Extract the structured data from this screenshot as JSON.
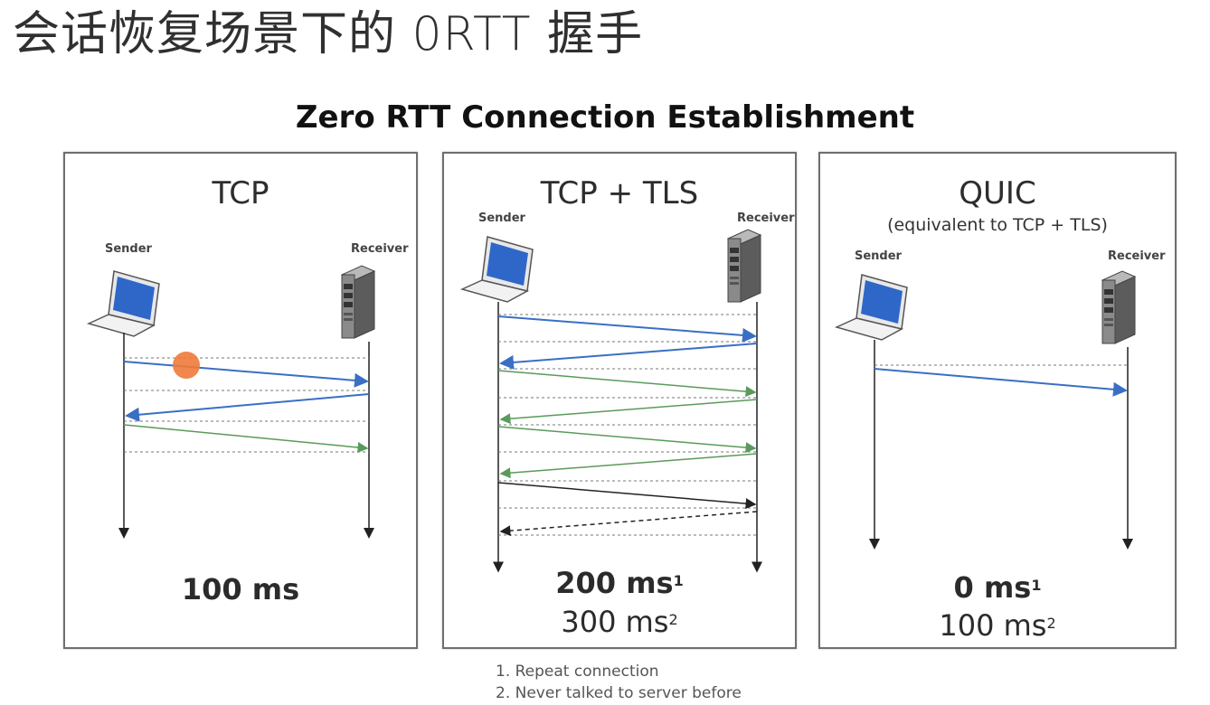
{
  "slide_title": "会话恢复场景下的 0RTT 握手",
  "figure_title": "Zero RTT Connection Establishment",
  "colors": {
    "blue_arrow": "#3a6fc4",
    "green_arrow": "#5a9a5a",
    "black_arrow": "#222222",
    "laptop_screen": "#2f67c8",
    "server_body": "#7a7a7a",
    "cursor": "#f07a3a"
  },
  "panels": {
    "tcp": {
      "title": "TCP",
      "sender": "Sender",
      "receiver": "Receiver",
      "timing_main": "100 ms"
    },
    "tls": {
      "title": "TCP + TLS",
      "sender": "Sender",
      "receiver": "Receiver",
      "timing_main": "200 ms",
      "timing_main_note": "1",
      "timing_sub": "300 ms",
      "timing_sub_note": "2"
    },
    "quic": {
      "title": "QUIC",
      "subtitle": "(equivalent to TCP + TLS)",
      "sender": "Sender",
      "receiver": "Receiver",
      "timing_main": "0 ms",
      "timing_main_note": "1",
      "timing_sub": "100 ms",
      "timing_sub_note": "2"
    }
  },
  "footnotes": [
    "1. Repeat connection",
    "2. Never talked to server before"
  ]
}
